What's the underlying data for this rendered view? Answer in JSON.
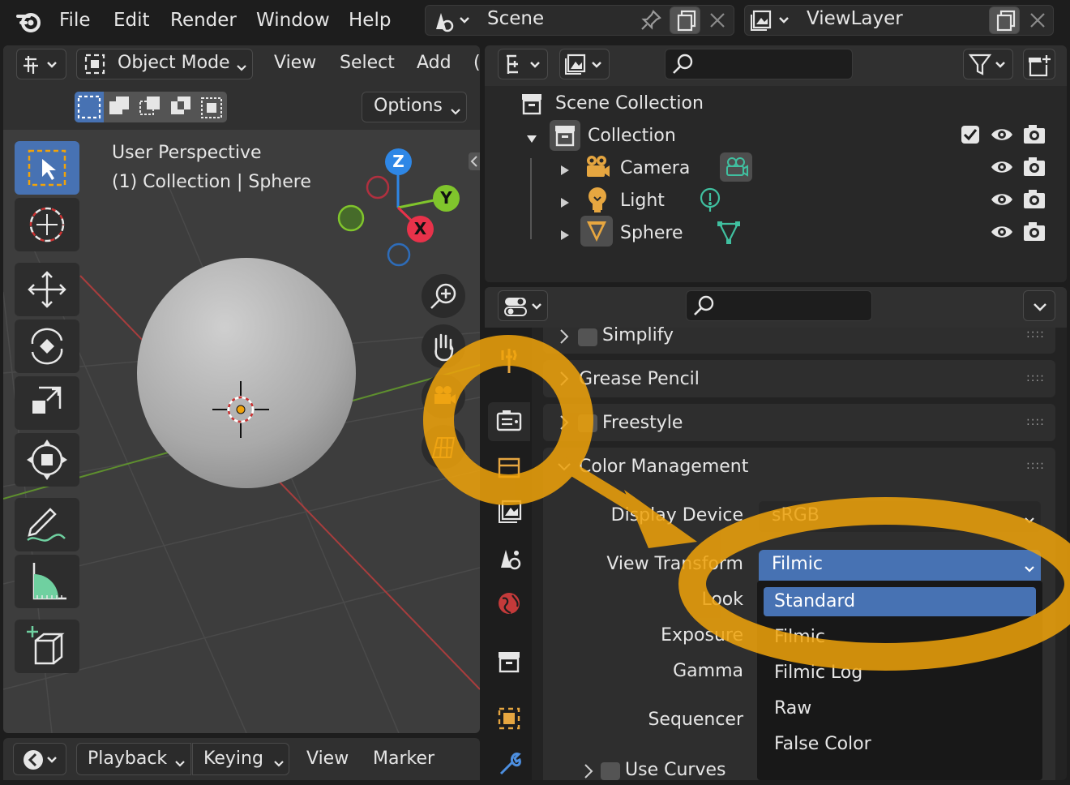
{
  "menu": {
    "file": "File",
    "edit": "Edit",
    "render": "Render",
    "window": "Window",
    "help": "Help"
  },
  "scene": {
    "name": "Scene"
  },
  "viewlayer": {
    "name": "ViewLayer"
  },
  "viewport": {
    "mode": "Object Mode",
    "menus": {
      "view": "View",
      "select": "Select",
      "add": "Add",
      "more": "("
    },
    "options": "Options",
    "overlay_line1": "User Perspective",
    "overlay_line2": "(1) Collection | Sphere",
    "gizmo": {
      "z": "Z",
      "y": "Y",
      "x": "X"
    }
  },
  "timeline": {
    "playback": "Playback",
    "keying": "Keying",
    "view": "View",
    "marker": "Marker"
  },
  "outliner": {
    "scene_collection": "Scene Collection",
    "collection": "Collection",
    "items": [
      {
        "label": "Camera"
      },
      {
        "label": "Light"
      },
      {
        "label": "Sphere"
      }
    ]
  },
  "properties": {
    "panels": {
      "simplify": "Simplify",
      "grease_pencil": "Grease Pencil",
      "freestyle": "Freestyle",
      "color_management": "Color Management",
      "use_curves": "Use Curves"
    },
    "fields": {
      "display_device_label": "Display Device",
      "display_device_value": "sRGB",
      "view_transform_label": "View Transform",
      "view_transform_value": "Filmic",
      "look_label": "Look",
      "exposure_label": "Exposure",
      "gamma_label": "Gamma",
      "sequencer_label": "Sequencer"
    },
    "dropdown_options": [
      "Standard",
      "Filmic",
      "Filmic Log",
      "Raw",
      "False Color"
    ]
  },
  "colors": {
    "accent": "#4772b3",
    "highlight": "#f0a30a",
    "axis_x": "#e8324a",
    "axis_y": "#80c52c",
    "axis_z": "#2e87e6"
  }
}
